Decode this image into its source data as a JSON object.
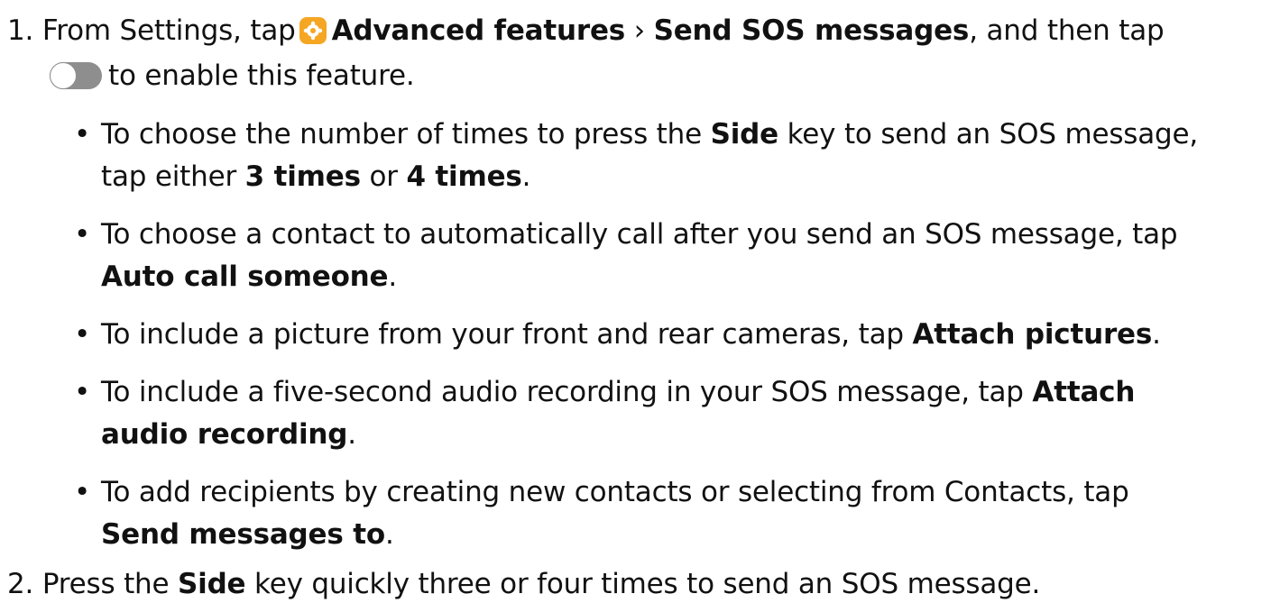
{
  "step1": {
    "number": "1.",
    "line1": {
      "t1": "From Settings, tap",
      "b1": "Advanced features",
      "sep": "›",
      "b2": "Send SOS messages",
      "t2": ", and then tap"
    },
    "line2": {
      "t1": "to enable this feature."
    },
    "settings_icon": "settings-gear-icon",
    "toggle_icon": "toggle-switch-off-icon",
    "bullets": [
      {
        "l1_t1": "To choose the number of times to press the",
        "l1_b1": "Side",
        "l1_t2": "key to send an SOS message,",
        "l2_t1": "tap either",
        "l2_b1": "3 times",
        "l2_t2": "or",
        "l2_b2": "4 times",
        "l2_t3": "."
      },
      {
        "l1_t1": "To choose a contact to automatically call after you send an SOS message, tap",
        "l2_b1": "Auto call someone",
        "l2_t2": "."
      },
      {
        "l1_t1": "To include a picture from your front and rear cameras, tap",
        "l1_b1": "Attach pictures",
        "l1_t2": "."
      },
      {
        "l1_t1": "To include a five-second audio recording in your SOS message, tap",
        "l1_b1": "Attach",
        "l2_b1": "audio recording",
        "l2_t2": "."
      },
      {
        "l1_t1": "To add recipients by creating new contacts or selecting from Contacts, tap",
        "l2_b1": "Send messages to",
        "l2_t2": "."
      }
    ]
  },
  "step2": {
    "number": "2.",
    "t1": "Press the",
    "b1": "Side",
    "t2": "key quickly three or four times to send an SOS message."
  },
  "colors": {
    "settings_icon_bg": "#f5a623",
    "toggle_track": "#8e8e8e",
    "text": "#111111"
  }
}
